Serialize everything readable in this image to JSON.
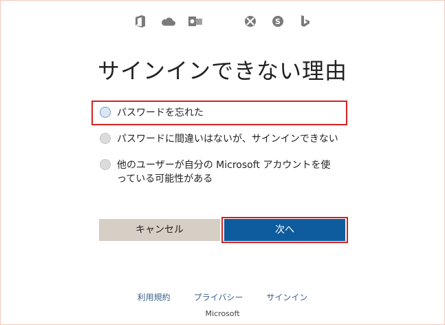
{
  "header": {
    "product_icons": [
      "office-icon",
      "onedrive-icon",
      "outlook-icon",
      "microsoft-logo",
      "xbox-icon",
      "skype-icon",
      "bing-icon"
    ],
    "logo_colors": [
      "#f25022",
      "#7fba00",
      "#00a4ef",
      "#ffb900"
    ],
    "icon_color": "#7a7a7a"
  },
  "page": {
    "title": "サインインできない理由"
  },
  "options": [
    {
      "label": "パスワードを忘れた",
      "selected": false,
      "highlighted": true
    },
    {
      "label": "パスワードに間違いはないが、サインインできない",
      "selected": false,
      "highlighted": false
    },
    {
      "label": "他のユーザーが自分の Microsoft アカウントを使っている可能性がある",
      "selected": false,
      "highlighted": false
    }
  ],
  "buttons": {
    "cancel_label": "キャンセル",
    "next_label": "次へ"
  },
  "footer": {
    "links": [
      "利用規約",
      "プライバシー",
      "サインイン"
    ],
    "brand": "Microsoft"
  },
  "colors": {
    "accent": "#0e5c9e",
    "highlight": "#d62020",
    "cancel_bg": "#d6cfc6"
  }
}
